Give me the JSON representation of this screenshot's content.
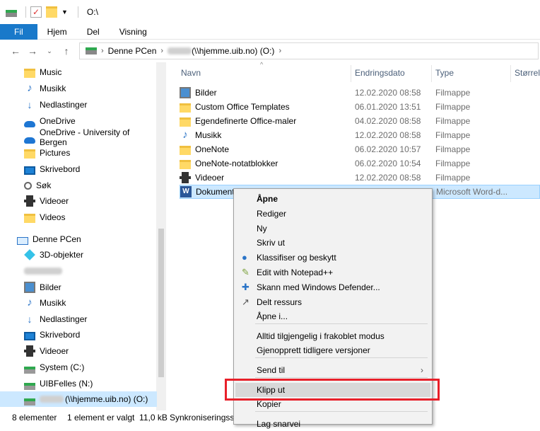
{
  "window": {
    "title": "O:\\"
  },
  "ribbon": {
    "tabs": [
      "Fil",
      "Hjem",
      "Del",
      "Visning"
    ]
  },
  "address": {
    "crumb1": "Denne PCen",
    "crumb2": "(\\\\hjemme.uib.no) (O:)"
  },
  "nav": {
    "items": [
      {
        "label": "Music",
        "icon": "folder"
      },
      {
        "label": "Musikk",
        "icon": "note"
      },
      {
        "label": "Nedlastinger",
        "icon": "down"
      },
      {
        "label": "OneDrive",
        "icon": "cloud"
      },
      {
        "label": "OneDrive - University of Bergen",
        "icon": "cloud"
      },
      {
        "label": "Pictures",
        "icon": "folder"
      },
      {
        "label": "Skrivebord",
        "icon": "desk"
      },
      {
        "label": "Søk",
        "icon": "mag"
      },
      {
        "label": "Videoer",
        "icon": "film"
      },
      {
        "label": "Videos",
        "icon": "folder"
      },
      {
        "label": "Denne PCen",
        "icon": "pc"
      },
      {
        "label": "3D-objekter",
        "icon": "cube"
      },
      {
        "label": "",
        "icon": "blur"
      },
      {
        "label": "Bilder",
        "icon": "pic"
      },
      {
        "label": "Musikk",
        "icon": "note"
      },
      {
        "label": "Nedlastinger",
        "icon": "down"
      },
      {
        "label": "Skrivebord",
        "icon": "desk"
      },
      {
        "label": "Videoer",
        "icon": "film"
      },
      {
        "label": "System (C:)",
        "icon": "drive"
      },
      {
        "label": "UIBFelles (N:)",
        "icon": "drive"
      },
      {
        "label": "(\\\\hjemme.uib.no) (O:)",
        "icon": "drive"
      }
    ]
  },
  "columns": {
    "name": "Navn",
    "date": "Endringsdato",
    "type": "Type",
    "size": "Størrels"
  },
  "files": [
    {
      "name": "Bilder",
      "date": "12.02.2020 08:58",
      "type": "Filmappe",
      "icon": "pic"
    },
    {
      "name": "Custom Office Templates",
      "date": "06.01.2020 13:51",
      "type": "Filmappe",
      "icon": "folder"
    },
    {
      "name": "Egendefinerte Office-maler",
      "date": "04.02.2020 08:58",
      "type": "Filmappe",
      "icon": "folder"
    },
    {
      "name": "Musikk",
      "date": "12.02.2020 08:58",
      "type": "Filmappe",
      "icon": "note"
    },
    {
      "name": "OneNote",
      "date": "06.02.2020 10:57",
      "type": "Filmappe",
      "icon": "folder"
    },
    {
      "name": "OneNote-notatblokker",
      "date": "06.02.2020 10:54",
      "type": "Filmappe",
      "icon": "folder"
    },
    {
      "name": "Videoer",
      "date": "12.02.2020 08:58",
      "type": "Filmappe",
      "icon": "film"
    },
    {
      "name": "Dokument",
      "date": "",
      "type": "Microsoft Word-d...",
      "icon": "word"
    }
  ],
  "context_menu": {
    "items": [
      {
        "label": "Åpne",
        "bold": true
      },
      {
        "label": "Rediger"
      },
      {
        "label": "Ny"
      },
      {
        "label": "Skriv ut"
      },
      {
        "label": "Klassifiser og beskytt",
        "icon": "shield"
      },
      {
        "label": "Edit with Notepad++",
        "icon": "notepad"
      },
      {
        "label": "Skann med Windows Defender...",
        "icon": "defender"
      },
      {
        "label": "Delt ressurs",
        "icon": "share"
      },
      {
        "label": "Åpne i..."
      },
      {
        "label": "Alltid tilgjengelig i frakoblet modus"
      },
      {
        "label": "Gjenopprett tidligere versjoner"
      },
      {
        "label": "Send til",
        "submenu": true
      },
      {
        "label": "Klipp ut",
        "highlight": true
      },
      {
        "label": "Kopier"
      },
      {
        "label": "Lag snarvei"
      }
    ]
  },
  "status": {
    "count": "8 elementer",
    "selection": "1 element er valgt  11,0 kB",
    "sync": "Synkroniseringssta"
  },
  "colors": {
    "accent": "#1979ca",
    "selection": "#cce8ff",
    "highlight_box": "#e8202a"
  }
}
